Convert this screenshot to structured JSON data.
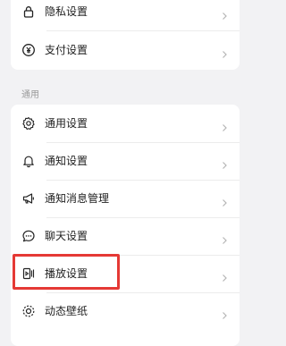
{
  "top_group": {
    "items": [
      {
        "label": "隐私设置",
        "icon": "lock-icon"
      },
      {
        "label": "支付设置",
        "icon": "yen-icon"
      }
    ]
  },
  "general_group": {
    "title": "通用",
    "items": [
      {
        "label": "通用设置",
        "icon": "gear-icon"
      },
      {
        "label": "通知设置",
        "icon": "bell-icon"
      },
      {
        "label": "通知消息管理",
        "icon": "megaphone-icon"
      },
      {
        "label": "聊天设置",
        "icon": "chat-bubble-icon"
      },
      {
        "label": "播放设置",
        "icon": "play-settings-icon"
      },
      {
        "label": "动态壁纸",
        "icon": "live-wallpaper-icon"
      }
    ]
  },
  "highlight": {
    "color": "#e53935"
  }
}
